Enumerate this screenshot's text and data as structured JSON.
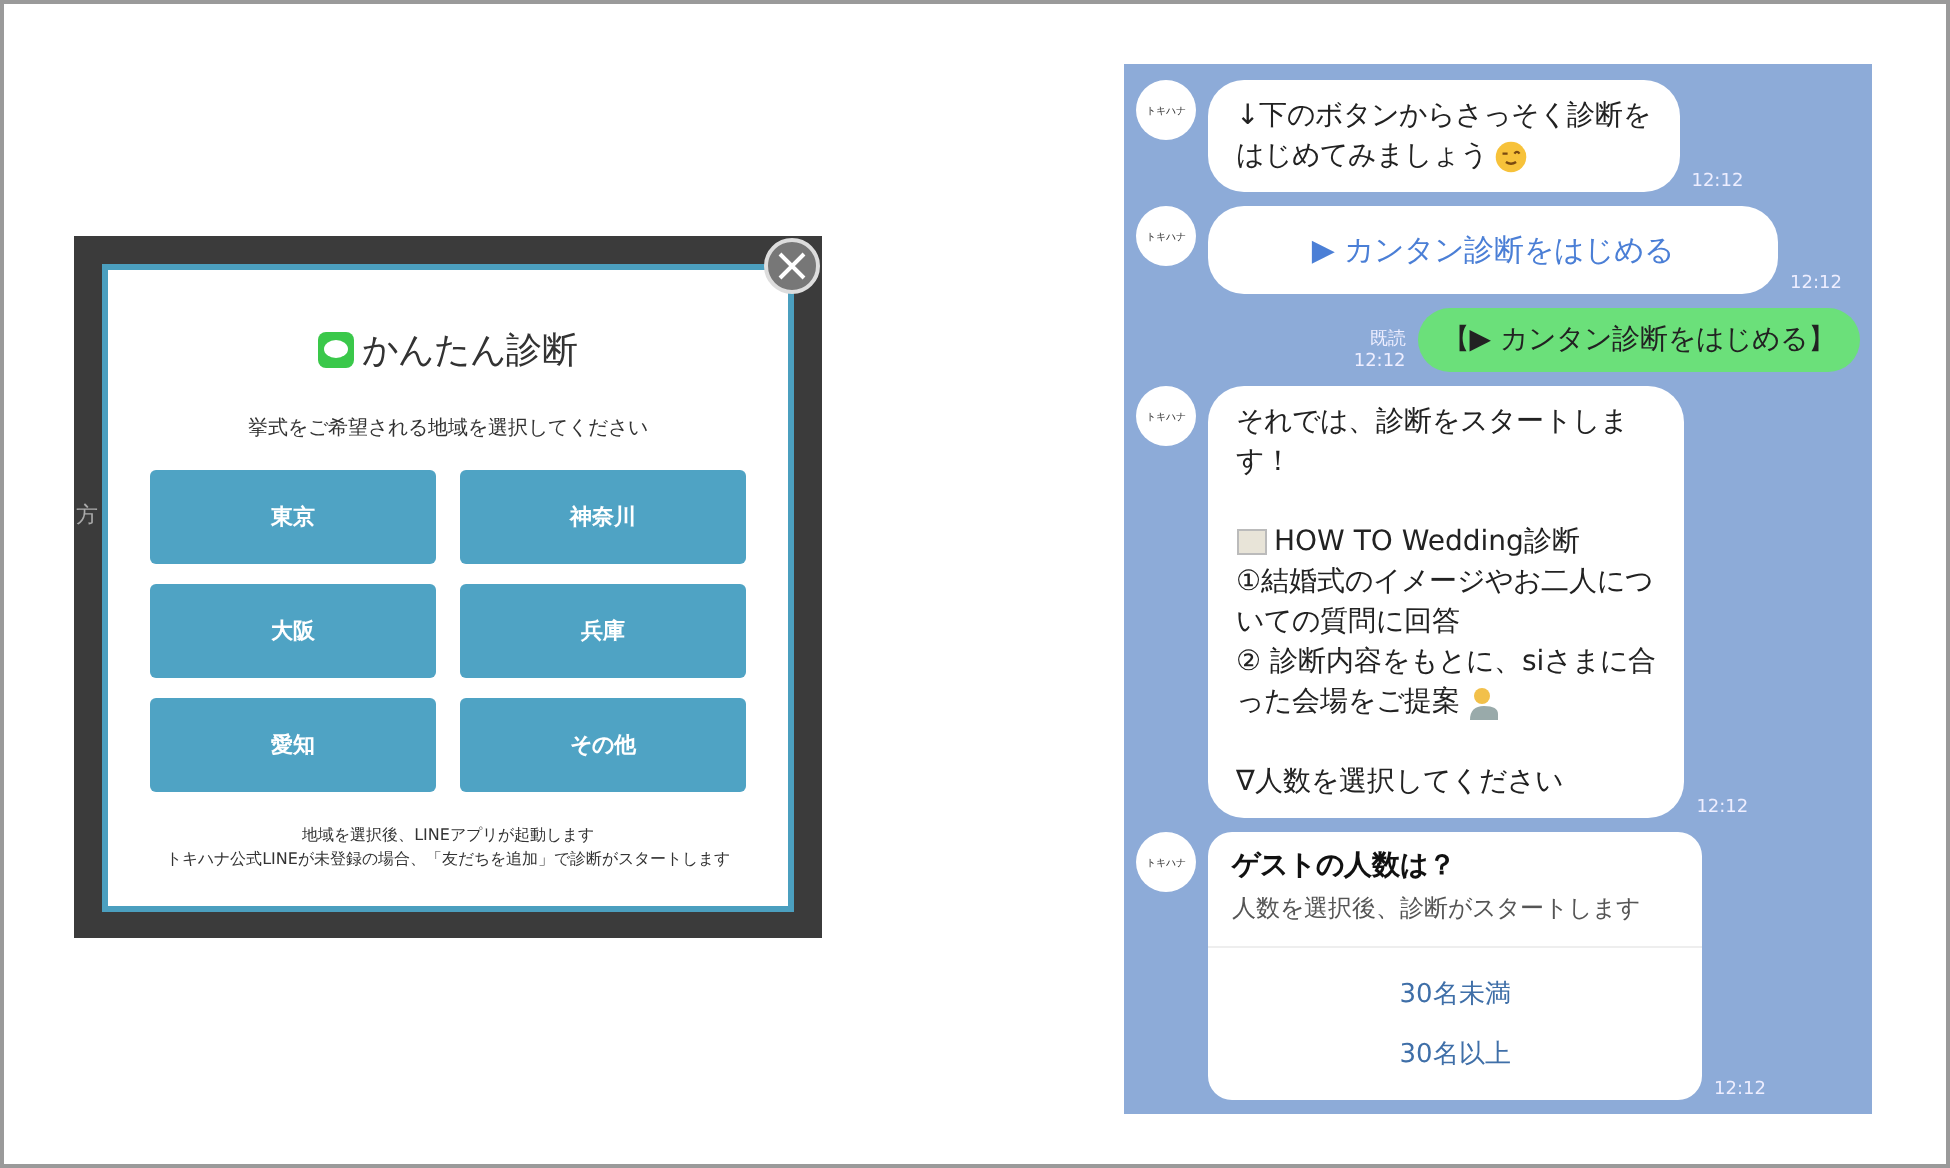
{
  "modal": {
    "title": "かんたん診断",
    "prompt": "挙式をご希望される地域を選択してください",
    "regions": [
      {
        "label": "東京"
      },
      {
        "label": "神奈川"
      },
      {
        "label": "大阪"
      },
      {
        "label": "兵庫"
      },
      {
        "label": "愛知"
      },
      {
        "label": "その他"
      }
    ],
    "notes": [
      "地域を選択後、LINEアプリが起動します",
      "トキハナ公式LINEが未登録の場合、「友だちを追加」で診断がスタートします"
    ]
  },
  "backdrop_text": "方",
  "chat": {
    "messages": [
      {
        "kind": "text",
        "avatar": "トキハナ",
        "paragraphs": [
          [
            "↓下のボタンからさっそく診断を",
            "はじめてみましょう"
          ]
        ],
        "emoji": true,
        "time": "12:12"
      },
      {
        "kind": "button",
        "avatar": "トキハナ",
        "text": "▶ カンタン診断をはじめる",
        "time": "12:12"
      },
      {
        "kind": "sent",
        "text": "【▶ カンタン診断をはじめる】",
        "read": "既読",
        "time": "12:12"
      },
      {
        "kind": "text",
        "avatar": "トキハナ",
        "paragraphs": [
          [
            "それでは、診断をスタートしま",
            "す！"
          ],
          [
            "HOW TO Wedding診断",
            "①結婚式のイメージやお二人につ",
            "いての質問に回答",
            "② 診断内容をもとに、siさまに合",
            "った会場をご提案"
          ],
          [
            "∇人数を選択してください"
          ]
        ],
        "time": "12:12"
      },
      {
        "kind": "card",
        "avatar": "トキハナ",
        "title": "ゲストの人数は？",
        "subtitle": "人数を選択後、診断がスタートします",
        "options": [
          "30名未満",
          "30名以上"
        ],
        "time": "12:12"
      }
    ]
  }
}
